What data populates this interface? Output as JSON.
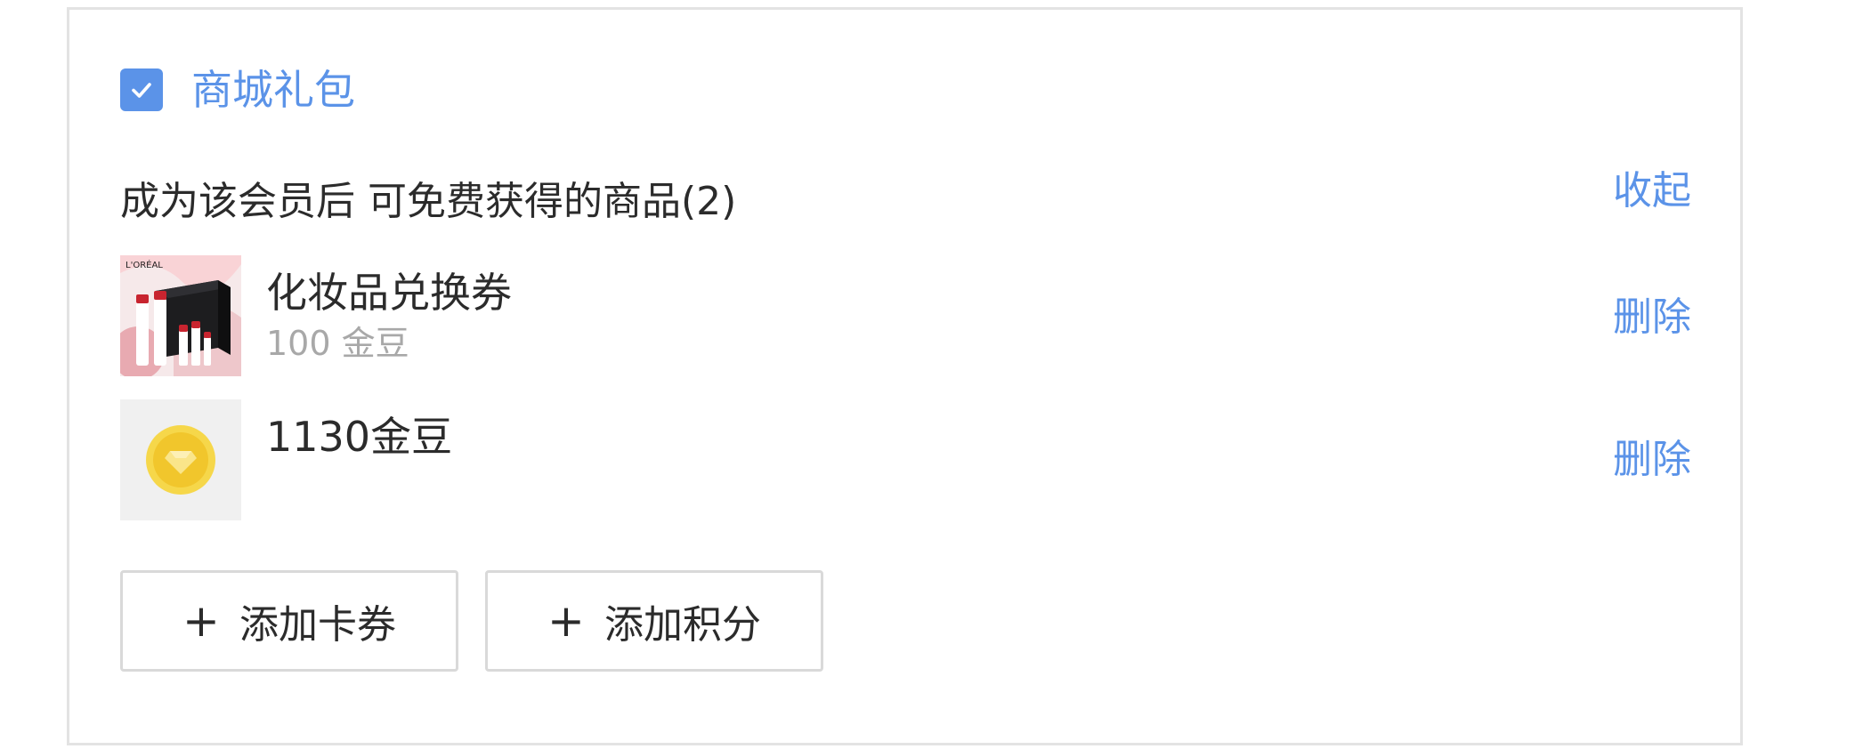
{
  "gift_section": {
    "checkbox_checked": true,
    "title": "商城礼包",
    "subtitle": "成为该会员后 可免费获得的商品(2)",
    "collapse_label": "收起",
    "accent_color": "#5b93e8",
    "items": [
      {
        "name": "化妆品兑换券",
        "sub": "100 金豆",
        "thumbnail": "cosmetics-gift-box",
        "brand_text": "L'ORÉAL",
        "delete_label": "删除"
      },
      {
        "name": "1130金豆",
        "thumbnail": "gold-coin-icon",
        "delete_label": "删除"
      }
    ],
    "buttons": {
      "add_coupon": "添加卡券",
      "add_points": "添加积分",
      "plus_symbol": "+"
    }
  }
}
